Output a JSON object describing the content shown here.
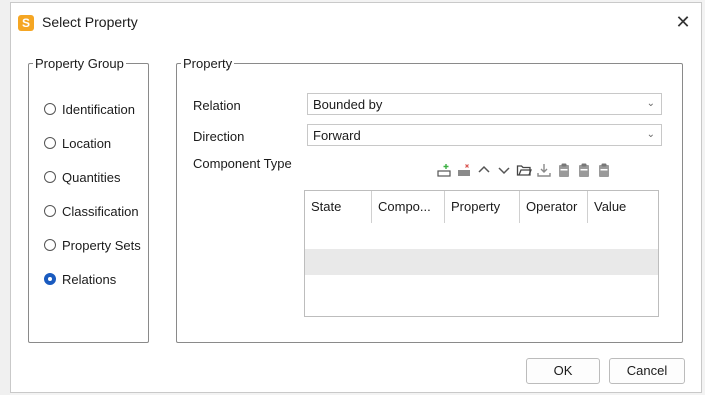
{
  "window": {
    "title": "Select Property",
    "icon_letter": "S",
    "icon_color": "#f5a623"
  },
  "property_group": {
    "legend": "Property Group",
    "options": [
      "Identification",
      "Location",
      "Quantities",
      "Classification",
      "Property Sets",
      "Relations"
    ],
    "selected": "Relations"
  },
  "property": {
    "legend": "Property",
    "relation_label": "Relation",
    "relation_value": "Bounded by",
    "direction_label": "Direction",
    "direction_value": "Forward",
    "component_type_label": "Component Type",
    "toolbar_icons": [
      "add-row-icon",
      "delete-row-icon",
      "move-up-icon",
      "move-down-icon",
      "open-folder-icon",
      "download-icon",
      "clipboard-icon",
      "clipboard-icon",
      "clipboard-icon"
    ],
    "table": {
      "columns": [
        "State",
        "Compo...",
        "Property",
        "Operator",
        "Value"
      ]
    }
  },
  "buttons": {
    "ok": "OK",
    "cancel": "Cancel"
  },
  "colors": {
    "accent": "#1a5bbf",
    "plus_green": "#3cb043",
    "delete_red": "#d9534f"
  }
}
